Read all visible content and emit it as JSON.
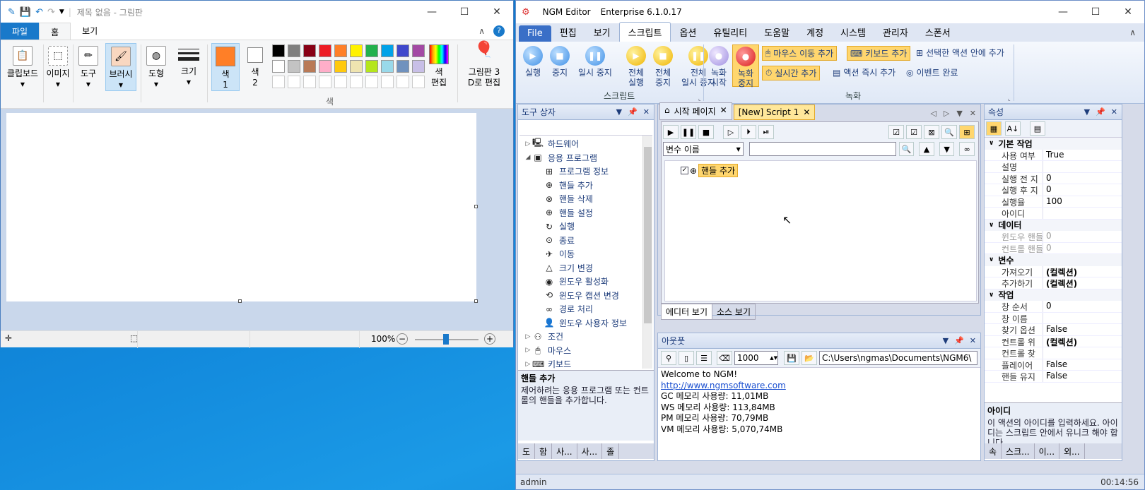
{
  "paint": {
    "title": "제목 없음 - 그림판",
    "tabs": [
      "파일",
      "홈",
      "보기"
    ],
    "tools": {
      "clipboard": "클립보드",
      "image": "이미지",
      "tools": "도구",
      "brush": "브러시",
      "shapes": "도형",
      "size": "크기",
      "color1": "색\n1",
      "color2": "색\n2",
      "edit_colors": "색\n편집",
      "paint3d": "그림판 3\nD로 편집"
    },
    "colors_group": "색",
    "palette_row1": [
      "#000000",
      "#7f7f7f",
      "#880015",
      "#ed1c24",
      "#ff7f27",
      "#fff200",
      "#22b14c",
      "#00a2e8",
      "#3f48cc",
      "#a349a4"
    ],
    "palette_row2": [
      "#ffffff",
      "#c3c3c3",
      "#b97a57",
      "#ffaec9",
      "#ffc90e",
      "#efe4b0",
      "#b5e61d",
      "#99d9ea",
      "#7092be",
      "#c8bfe7"
    ],
    "color1_value": "#ff7f27",
    "zoom": "100%"
  },
  "ngm": {
    "title": "NGM Editor",
    "edition": "Enterprise 6.1.0.17",
    "menu": [
      "File",
      "편집",
      "보기",
      "스크립트",
      "옵션",
      "유틸리티",
      "도움말",
      "계정",
      "시스템",
      "관리자",
      "스폰서"
    ],
    "ribbon": {
      "run": "실행",
      "stop": "중지",
      "pause": "일시 중지",
      "all_run": "전체\n실행",
      "all_stop": "전체\n중지",
      "all_pause": "전체\n일시 중지",
      "rec_start": "녹화\n시작",
      "rec_stop": "녹화\n중지",
      "add_mouse": "마우스 이동 추가",
      "add_keyboard": "키보드 추가",
      "add_in_selected": "선택한 액션 안에 추가",
      "add_realtime": "실시간 추가",
      "add_action_now": "액션 즉시 추가",
      "event_done": "이벤트 완료",
      "group_script": "스크립트",
      "group_record": "녹화"
    },
    "toolbox": {
      "title": "도구 상자",
      "items": [
        {
          "label": "하드웨어",
          "level": 0,
          "exp": "▷",
          "icon": "🖳"
        },
        {
          "label": "응용 프로그램",
          "level": 0,
          "exp": "◢",
          "icon": "▣"
        },
        {
          "label": "프로그램 정보",
          "level": 1,
          "exp": "",
          "icon": "⊞"
        },
        {
          "label": "핸들 추가",
          "level": 1,
          "exp": "",
          "icon": "⊕"
        },
        {
          "label": "핸들 삭제",
          "level": 1,
          "exp": "",
          "icon": "⊗"
        },
        {
          "label": "핸들 설정",
          "level": 1,
          "exp": "",
          "icon": "⊕"
        },
        {
          "label": "실행",
          "level": 1,
          "exp": "",
          "icon": "↻"
        },
        {
          "label": "종료",
          "level": 1,
          "exp": "",
          "icon": "⊙"
        },
        {
          "label": "이동",
          "level": 1,
          "exp": "",
          "icon": "✈"
        },
        {
          "label": "크기 변경",
          "level": 1,
          "exp": "",
          "icon": "△"
        },
        {
          "label": "윈도우 활성화",
          "level": 1,
          "exp": "",
          "icon": "◉"
        },
        {
          "label": "윈도우 캡션 변경",
          "level": 1,
          "exp": "",
          "icon": "⟲"
        },
        {
          "label": "경로 처리",
          "level": 1,
          "exp": "",
          "icon": "∞"
        },
        {
          "label": "윈도우 사용자 정보",
          "level": 1,
          "exp": "",
          "icon": "👤"
        },
        {
          "label": "조건",
          "level": 0,
          "exp": "▷",
          "icon": "⚇"
        },
        {
          "label": "마우스",
          "level": 0,
          "exp": "▷",
          "icon": "🖱"
        },
        {
          "label": "키보드",
          "level": 0,
          "exp": "▷",
          "icon": "⌨"
        }
      ],
      "desc_title": "핸들 추가",
      "desc_text": "제어하려는 응용 프로그램 또는 컨트롤의 핸들을 추가합니다.",
      "bottom_tabs": [
        "도",
        "함",
        "사...",
        "사...",
        "졸"
      ]
    },
    "editor": {
      "tabs": [
        "시작 페이지",
        "[New] Script 1"
      ],
      "var_placeholder": "변수 이름",
      "node_label": "핸들 추가",
      "bottom_tabs": [
        "에디터 보기",
        "소스 보기"
      ]
    },
    "output": {
      "title": "아웃풋",
      "count": "1000",
      "path": "C:\\Users\\ngmas\\Documents\\NGM6\\",
      "lines": [
        "Welcome to NGM!",
        "http://www.ngmsoftware.com",
        "GC 메모리 사용량: 11,01MB",
        "WS 메모리 사용량: 113,84MB",
        "PM 메모리 사용량: 70,79MB",
        "VM 메모리 사용량: 5,070,74MB"
      ]
    },
    "properties": {
      "title": "속성",
      "categories": [
        {
          "name": "기본 작업",
          "rows": [
            [
              "사용 여부",
              "True"
            ],
            [
              "설명",
              ""
            ],
            [
              "실행 전 지",
              "0"
            ],
            [
              "실행 후 지",
              "0"
            ],
            [
              "실행율",
              "100"
            ],
            [
              "아이디",
              ""
            ]
          ]
        },
        {
          "name": "데이터",
          "rows": [
            [
              "윈도우 핸들",
              "0"
            ],
            [
              "컨트롤 핸들",
              "0"
            ]
          ]
        },
        {
          "name": "변수",
          "rows": [
            [
              "가져오기",
              "(컬렉션)"
            ],
            [
              "추가하기",
              "(컬렉션)"
            ]
          ]
        },
        {
          "name": "작업",
          "rows": [
            [
              "창 순서",
              "0"
            ],
            [
              "창 이름",
              ""
            ],
            [
              "찾기 옵션",
              "False"
            ],
            [
              "컨트롤 위",
              "(컬렉션)"
            ],
            [
              "컨트롤 찾",
              ""
            ],
            [
              "플레이어 ",
              "False"
            ],
            [
              "핸들 유지",
              "False"
            ]
          ]
        }
      ],
      "desc_title": "아이디",
      "desc_text": "이 액션의 아이디를 입력하세요. 아이디는 스크립트 안에서 유니크 해야 합니다.",
      "bottom_tabs": [
        "속",
        "스크...",
        "이...",
        "외..."
      ]
    },
    "status_user": "admin",
    "status_time": "00:14:56"
  }
}
